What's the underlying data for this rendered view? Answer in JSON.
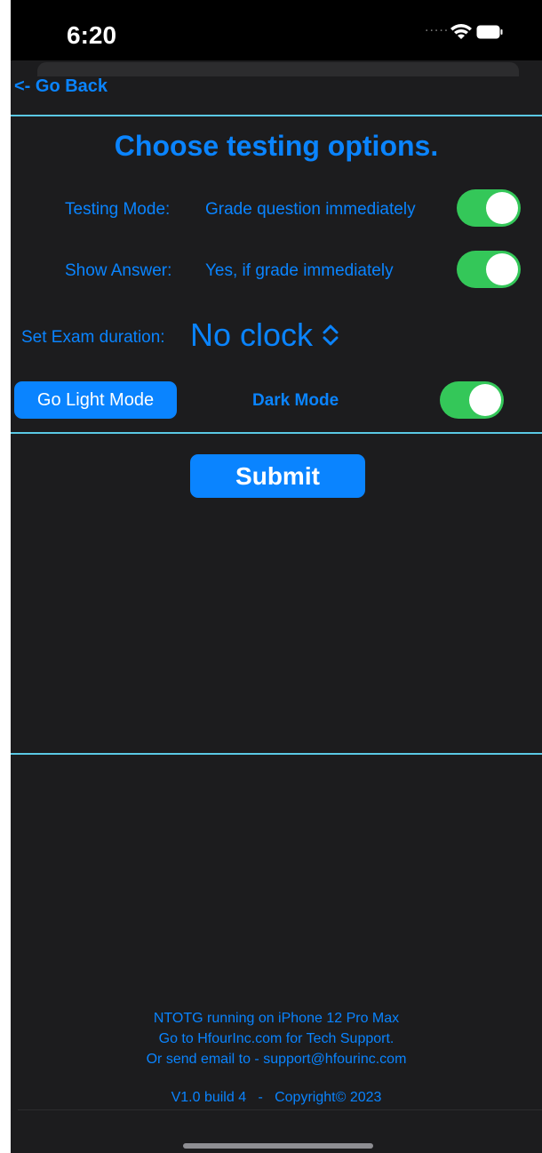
{
  "status_bar": {
    "time": "6:20",
    "signal": "....."
  },
  "nav": {
    "back_label": "<- Go Back"
  },
  "page": {
    "title": "Choose testing options."
  },
  "settings": {
    "testing_mode": {
      "label": "Testing Mode:",
      "value": "Grade question immediately",
      "enabled": true
    },
    "show_answer": {
      "label": "Show Answer:",
      "value": "Yes, if grade immediately",
      "enabled": true
    },
    "exam_duration": {
      "label": "Set Exam duration:",
      "value": "No clock"
    },
    "appearance": {
      "button_label": "Go Light Mode",
      "mode_label": "Dark Mode",
      "dark_enabled": true
    }
  },
  "actions": {
    "submit_label": "Submit"
  },
  "footer": {
    "device_line": "NTOTG running on iPhone 12 Pro Max",
    "support_line": "Go to HfourInc.com for Tech Support.",
    "email_line": "Or send email to - support@hfourinc.com",
    "version_line": "V1.0 build 4   -   Copyright© 2023"
  },
  "colors": {
    "accent": "#0a84ff",
    "toggle_on": "#34c759",
    "divider": "#5ac8e4",
    "background": "#1c1c1e"
  }
}
